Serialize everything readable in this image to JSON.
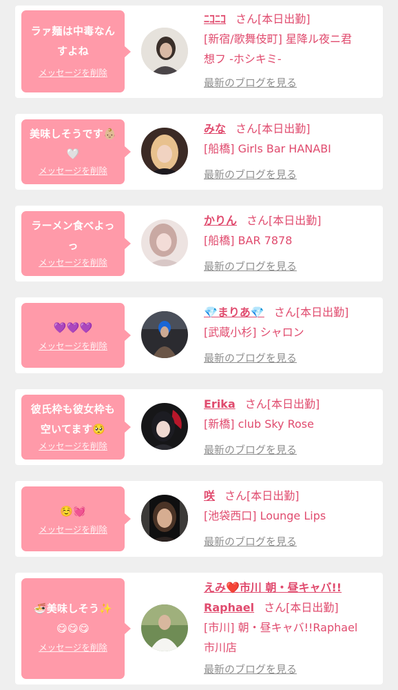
{
  "colors": {
    "background": "#efefef",
    "bubble": "#ff9aa9",
    "accent_text": "#e04b6e",
    "muted_text": "#8f8f8f"
  },
  "common": {
    "delete_label": "メッセージを削除",
    "blog_label": "最新のブログを見る",
    "status_suffix": "さん[本日出勤]"
  },
  "entries": [
    {
      "message_lines": [
        "ラァ麺は中毒なん",
        "すよね"
      ],
      "name": "ﾆｺﾆｺ",
      "shop_lines": [
        "[新宿/歌舞伎町] 星降ル夜ニ君",
        "想フ -ホシキミ-"
      ],
      "avatar": "avatar-photo"
    },
    {
      "message_lines": [
        "美味しそうです👶🏼",
        "🤍"
      ],
      "name": "みな",
      "shop_lines": [
        "[船橋] Girls Bar HANABI"
      ],
      "avatar": "avatar-photo"
    },
    {
      "message_lines": [
        "ラーメン食べよっ",
        "っ"
      ],
      "name": "かりん",
      "shop_lines": [
        "[船橋] BAR 7878"
      ],
      "avatar": "avatar-photo"
    },
    {
      "message_lines": [
        "💜💜💜"
      ],
      "name": "💎まりあ💎",
      "shop_lines": [
        "[武蔵小杉] シャロン"
      ],
      "avatar": "avatar-photo"
    },
    {
      "message_lines": [
        "彼氏枠も彼女枠も",
        "空いてます🥺"
      ],
      "name": "Erika",
      "shop_lines": [
        "[新橋] club Sky Rose"
      ],
      "avatar": "avatar-photo"
    },
    {
      "message_lines": [
        "☺️💓"
      ],
      "name": "咲",
      "shop_lines": [
        "[池袋西口] Lounge Lips"
      ],
      "avatar": "avatar-photo"
    },
    {
      "message_lines": [
        "🍜美味しそう✨",
        "😋😋😋"
      ],
      "name_lines": [
        "えみ❤️市川 朝・昼キャバ!!",
        "Raphael"
      ],
      "shop_lines": [
        "[市川] 朝・昼キャバ!!Raphael",
        "市川店"
      ],
      "avatar": "avatar-photo"
    }
  ]
}
